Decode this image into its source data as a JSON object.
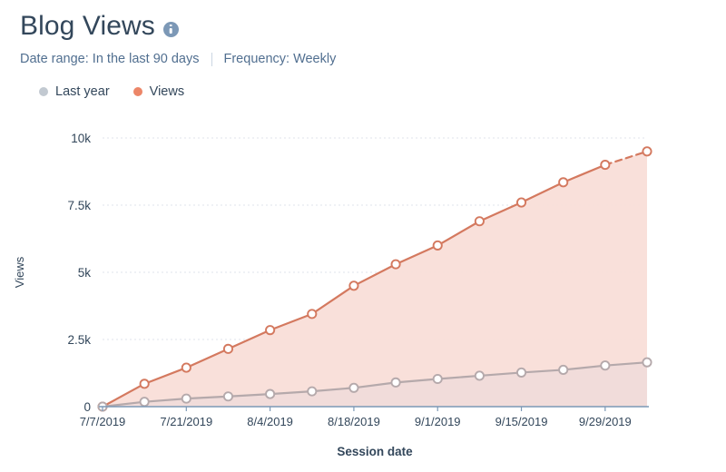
{
  "header": {
    "title": "Blog Views",
    "info_icon": "info-icon",
    "date_range": "Date range: In the last 90 days",
    "frequency": "Frequency: Weekly"
  },
  "legend": {
    "items": [
      {
        "label": "Last year",
        "color": "#c2c9d1",
        "marker": "circle-dot"
      },
      {
        "label": "Views",
        "color": "#ec8668",
        "marker": "circle-dot"
      }
    ]
  },
  "colors": {
    "views_line": "#d4795f",
    "views_fill": "#f9ded8",
    "lastyear_line": "#b5a9ab",
    "lastyear_fill": "#efdcd9",
    "gridline": "#dfe3eb",
    "axis": "#7c98b6",
    "text": "#33475b",
    "subtext": "#516f90"
  },
  "chart_data": {
    "type": "area",
    "title": "Blog Views",
    "xlabel": "Session date",
    "ylabel": "Views",
    "ylim": [
      0,
      10000
    ],
    "ytick_labels": [
      "0",
      "2.5k",
      "5k",
      "7.5k",
      "10k"
    ],
    "ytick_values": [
      0,
      2500,
      5000,
      7500,
      10000
    ],
    "grid": true,
    "legend_position": "top-left",
    "x": [
      "7/7/2019",
      "7/14/2019",
      "7/21/2019",
      "7/28/2019",
      "8/4/2019",
      "8/11/2019",
      "8/18/2019",
      "8/25/2019",
      "9/1/2019",
      "9/8/2019",
      "9/15/2019",
      "9/22/2019",
      "9/29/2019",
      "10/6/2019"
    ],
    "xtick_labels": [
      "7/7/2019",
      "7/21/2019",
      "8/4/2019",
      "8/18/2019",
      "9/1/2019",
      "9/15/2019",
      "9/29/2019"
    ],
    "xtick_indices": [
      0,
      2,
      4,
      6,
      8,
      10,
      12
    ],
    "last_segment_dashed": true,
    "series": [
      {
        "name": "Views",
        "color": "#d4795f",
        "fill": "#f9ded8",
        "values": [
          0,
          850,
          1450,
          2150,
          2850,
          3450,
          4500,
          5300,
          6000,
          6900,
          7600,
          8350,
          9000,
          9500
        ]
      },
      {
        "name": "Last year",
        "color": "#b5a9ab",
        "fill": "#efdcd9",
        "values": [
          0,
          180,
          300,
          380,
          470,
          570,
          700,
          900,
          1030,
          1150,
          1270,
          1370,
          1530,
          1650
        ]
      }
    ]
  }
}
